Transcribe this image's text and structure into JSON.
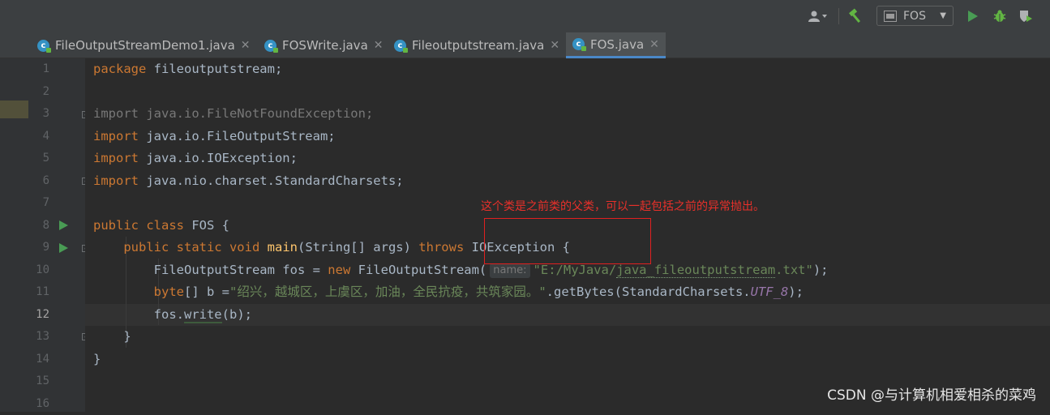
{
  "toolbar": {
    "run_config_label": "FOS",
    "icons": [
      "user-icon",
      "build-hammer-icon",
      "run-config-icon",
      "run-icon",
      "debug-icon",
      "coverage-icon"
    ],
    "colors": {
      "run": "#499c54",
      "debug": "#62b543",
      "hammer": "#62b543"
    }
  },
  "tabs": [
    {
      "label": "FileOutputStreamDemo1.java",
      "active": false
    },
    {
      "label": "FOSWrite.java",
      "active": false
    },
    {
      "label": "Fileoutputstream.java",
      "active": false
    },
    {
      "label": "FOS.java",
      "active": true
    }
  ],
  "editor": {
    "line_numbers": [
      "1",
      "2",
      "3",
      "4",
      "5",
      "6",
      "7",
      "8",
      "9",
      "10",
      "11",
      "12",
      "13",
      "14",
      "15",
      "16"
    ],
    "current_line": "12",
    "code": {
      "l1_kw": "package",
      "l1_rest": " fileoutputstream;",
      "l3": "import java.io.FileNotFoundException;",
      "import_kw": "import",
      "l4_rest": " java.io.FileOutputStream;",
      "l5_rest": " java.io.IOException;",
      "l6_rest": " java.nio.charset.StandardCharsets;",
      "l8_kw": "public class",
      "l8_rest": " FOS {",
      "l9_kw1": "public static void",
      "l9_fn": "main",
      "l9_mid": "(String[] args) ",
      "l9_kw2": "throws",
      "l9_rest": " IOException {",
      "l10_a": "FileOutputStream fos = ",
      "l10_kw": "new",
      "l10_b": " FileOutputStream(",
      "l10_hint": "name:",
      "l10_str1": "\"E:/MyJava/",
      "l10_str2": "java_fileoutputstream",
      "l10_str3": ".txt\"",
      "l10_end": ");",
      "l11_kw": "byte",
      "l11_a": "[] b =",
      "l11_str": "\"绍兴，越城区，上虞区，加油，全民抗疫，共筑家园。\"",
      "l11_b": ".getBytes(StandardCharsets.",
      "l11_const": "UTF_8",
      "l11_end": ");",
      "l12_a": "fos.",
      "l12_method": "write",
      "l12_end": "(b);",
      "l13": "}",
      "l14": "}"
    }
  },
  "annotation": {
    "text": "这个类是之前类的父类，可以一起包括之前的异常抛出。",
    "color": "#e8302a"
  },
  "watermark": "CSDN @与计算机相爱相杀的菜鸡"
}
